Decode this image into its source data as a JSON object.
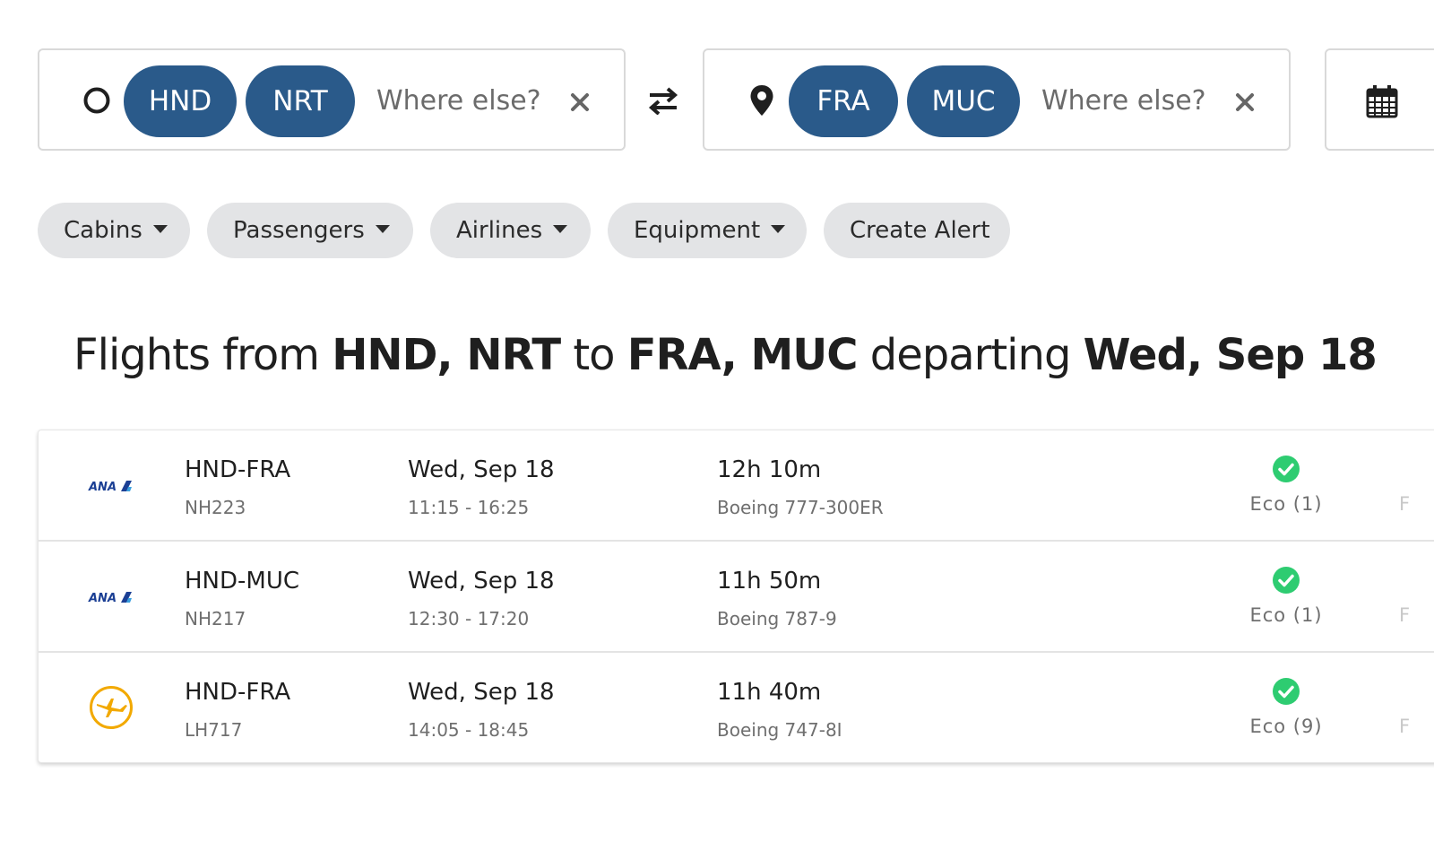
{
  "search": {
    "origin": {
      "chips": [
        "HND",
        "NRT"
      ],
      "placeholder": "Where else?",
      "icon": "circle-outline-icon"
    },
    "destination": {
      "chips": [
        "FRA",
        "MUC"
      ],
      "placeholder": "Where else?",
      "icon": "map-pin-icon"
    },
    "swap_icon": "swap-arrows-icon",
    "date_icon": "calendar-icon"
  },
  "filters": {
    "cabins": "Cabins",
    "passengers": "Passengers",
    "airlines": "Airlines",
    "equipment": "Equipment",
    "create_alert": "Create Alert"
  },
  "heading": {
    "prefix": "Flights from ",
    "origins": "HND, NRT",
    "to": " to ",
    "destinations": "FRA, MUC",
    "departing": " departing ",
    "date": "Wed, Sep 18"
  },
  "flights": [
    {
      "airline_logo": "ana-logo",
      "route": "HND-FRA",
      "flight_no": "NH223",
      "date": "Wed, Sep 18",
      "times": "11:15 - 16:25",
      "duration": "12h 10m",
      "aircraft": "Boeing 777-300ER",
      "cabin": "Eco (1)",
      "edge": "F"
    },
    {
      "airline_logo": "ana-logo",
      "route": "HND-MUC",
      "flight_no": "NH217",
      "date": "Wed, Sep 18",
      "times": "12:30 - 17:20",
      "duration": "11h 50m",
      "aircraft": "Boeing 787-9",
      "cabin": "Eco (1)",
      "edge": "F"
    },
    {
      "airline_logo": "lufthansa-logo",
      "route": "HND-FRA",
      "flight_no": "LH717",
      "date": "Wed, Sep 18",
      "times": "14:05 - 18:45",
      "duration": "11h 40m",
      "aircraft": "Boeing 747-8I",
      "cabin": "Eco (9)",
      "edge": "F"
    }
  ],
  "colors": {
    "chip": "#2a5a8a",
    "pill": "#e3e4e6",
    "check": "#2ecc71",
    "lufthansa": "#f2a900",
    "ana": "#1b3f94"
  }
}
